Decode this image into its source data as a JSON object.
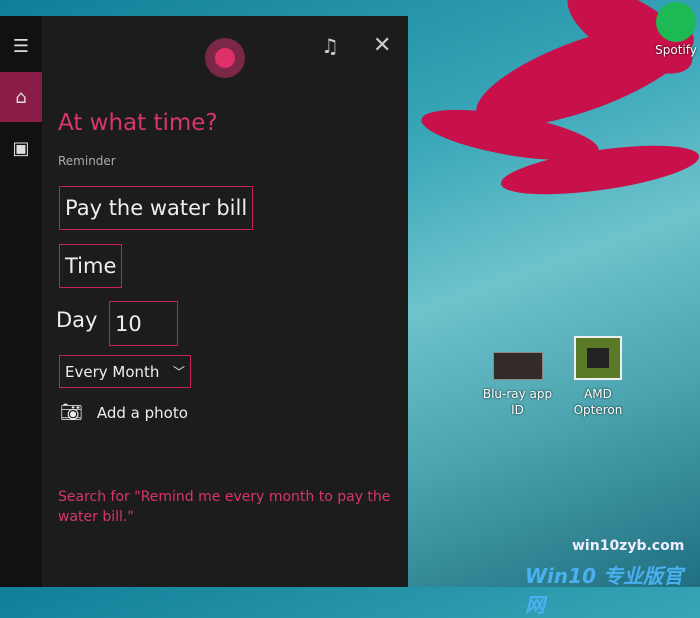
{
  "cortana": {
    "heading": "At what time?",
    "label": "Reminder",
    "reminder_text": "Pay the water bill",
    "time_field": "Time",
    "day_label": "Day",
    "day_value": "10",
    "recurrence": "Every Month",
    "add_photo": "Add a photo",
    "search_link": "Search for \"Remind me every month to pay the water bill.\""
  },
  "desktop": {
    "icons": [
      {
        "label": "Spotify"
      },
      {
        "label": "Blu-ray app ID"
      },
      {
        "label": "AMD Opteron"
      }
    ],
    "watermark_url": "win10zyb.com",
    "watermark_logo": "Win10 专业版官网"
  },
  "colors": {
    "accent": "#d8346e",
    "panel": "#1c1c1c"
  }
}
